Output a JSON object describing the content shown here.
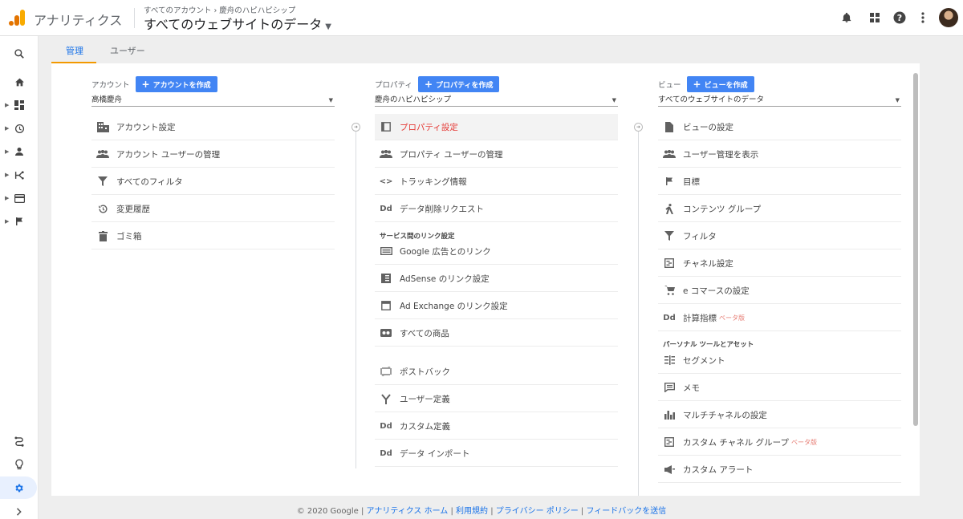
{
  "header": {
    "brand": "アナリティクス",
    "breadcrumb": "すべてのアカウント › 慶舟のハピハピシップ",
    "view_selector": "すべてのウェブサイトのデータ"
  },
  "tabs": [
    {
      "label": "管理"
    },
    {
      "label": "ユーザー"
    }
  ],
  "account": {
    "label": "アカウント",
    "create_button": "アカウントを作成",
    "selected": "高橋慶舟",
    "items": [
      {
        "label": "アカウント設定",
        "icon": "building-icon"
      },
      {
        "label": "アカウント ユーザーの管理",
        "icon": "people-icon"
      },
      {
        "label": "すべてのフィルタ",
        "icon": "filter-icon"
      },
      {
        "label": "変更履歴",
        "icon": "history-icon"
      },
      {
        "label": "ゴミ箱",
        "icon": "trash-icon"
      }
    ]
  },
  "property": {
    "label": "プロパティ",
    "create_button": "プロパティを作成",
    "selected": "慶舟のハピハピシップ",
    "items": [
      {
        "label": "プロパティ設定",
        "icon": "property-icon"
      },
      {
        "label": "プロパティ ユーザーの管理",
        "icon": "people-icon"
      },
      {
        "label": "トラッキング情報",
        "icon": "code-icon"
      },
      {
        "label": "データ削除リクエスト",
        "icon": "dd-icon"
      }
    ],
    "links_section": "サービス間のリンク設定",
    "link_items": [
      {
        "label": "Google 広告とのリンク",
        "icon": "ads-icon"
      },
      {
        "label": "AdSense のリンク設定",
        "icon": "adsense-icon"
      },
      {
        "label": "Ad Exchange のリンク設定",
        "icon": "adexchange-icon"
      },
      {
        "label": "すべての商品",
        "icon": "products-icon"
      }
    ],
    "more_items": [
      {
        "label": "ポストバック",
        "icon": "postback-icon"
      },
      {
        "label": "ユーザー定義",
        "icon": "fork-icon"
      },
      {
        "label": "カスタム定義",
        "icon": "dd-icon"
      },
      {
        "label": "データ インポート",
        "icon": "dd-icon"
      }
    ]
  },
  "view": {
    "label": "ビュー",
    "create_button": "ビューを作成",
    "selected": "すべてのウェブサイトのデータ",
    "items": [
      {
        "label": "ビューの設定",
        "icon": "document-icon"
      },
      {
        "label": "ユーザー管理を表示",
        "icon": "people-icon"
      },
      {
        "label": "目標",
        "icon": "flag-icon"
      },
      {
        "label": "コンテンツ グループ",
        "icon": "hiker-icon"
      },
      {
        "label": "フィルタ",
        "icon": "filter-icon"
      },
      {
        "label": "チャネル設定",
        "icon": "channel-icon"
      },
      {
        "label": "e コマースの設定",
        "icon": "cart-icon"
      },
      {
        "label": "計算指標",
        "icon": "dd-icon",
        "beta": "ベータ版"
      }
    ],
    "personal_section": "パーソナル ツールとアセット",
    "personal_items": [
      {
        "label": "セグメント",
        "icon": "segment-icon"
      },
      {
        "label": "メモ",
        "icon": "comment-icon"
      },
      {
        "label": "マルチチャネルの設定",
        "icon": "bar-chart-icon"
      },
      {
        "label": "カスタム チャネル グループ",
        "icon": "channel-icon",
        "beta": "ベータ版"
      },
      {
        "label": "カスタム アラート",
        "icon": "megaphone-icon"
      }
    ]
  },
  "footer": {
    "copyright": "© 2020 Google",
    "links": [
      "アナリティクス ホーム",
      "利用規約",
      "プライバシー ポリシー",
      "フィードバックを送信"
    ]
  }
}
